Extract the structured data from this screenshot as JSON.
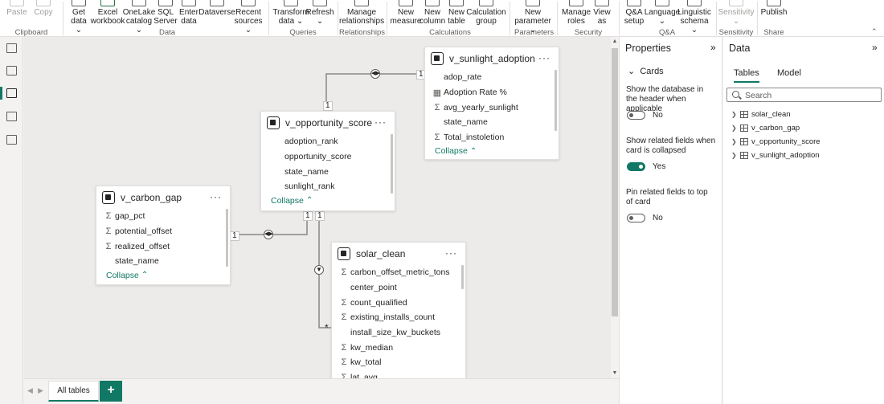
{
  "ribbon": {
    "buttons": [
      {
        "label": "Paste",
        "disabled": true
      },
      {
        "label": "Copy",
        "disabled": true
      },
      {
        "label": "Get data ⌄",
        "disabled": false
      },
      {
        "label": "Excel workbook",
        "disabled": false
      },
      {
        "label": "OneLake catalog ⌄",
        "disabled": false
      },
      {
        "label": "SQL Server",
        "disabled": false
      },
      {
        "label": "Enter data",
        "disabled": false
      },
      {
        "label": "Dataverse",
        "disabled": false
      },
      {
        "label": "Recent sources ⌄",
        "disabled": false
      },
      {
        "label": "Transform data ⌄",
        "disabled": false
      },
      {
        "label": "Refresh ⌄",
        "disabled": false
      },
      {
        "label": "Manage relationships",
        "disabled": false
      },
      {
        "label": "New measure",
        "disabled": false
      },
      {
        "label": "New column",
        "disabled": false
      },
      {
        "label": "New table",
        "disabled": false
      },
      {
        "label": "Calculation group",
        "disabled": false
      },
      {
        "label": "New parameter ⌄",
        "disabled": false
      },
      {
        "label": "Manage roles",
        "disabled": false
      },
      {
        "label": "View as",
        "disabled": false
      },
      {
        "label": "Q&A setup",
        "disabled": false
      },
      {
        "label": "Language ⌄",
        "disabled": false
      },
      {
        "label": "Linguistic schema ⌄",
        "disabled": false
      },
      {
        "label": "Sensitivity ⌄",
        "disabled": true
      },
      {
        "label": "Publish",
        "disabled": false
      }
    ],
    "groups": [
      "Clipboard",
      "Data",
      "Queries",
      "Relationships",
      "Calculations",
      "Parameters",
      "Security",
      "Q&A",
      "Sensitivity",
      "Share"
    ]
  },
  "cards": {
    "v_sunlight_adoption": {
      "title": "v_sunlight_adoption",
      "fields": [
        {
          "name": "adop_rate",
          "icon": ""
        },
        {
          "name": "Adoption Rate %",
          "icon": "measure-icon"
        },
        {
          "name": "avg_yearly_sunlight",
          "icon": "sigma"
        },
        {
          "name": "state_name",
          "icon": ""
        },
        {
          "name": "Total_instoletion",
          "icon": "sigma"
        }
      ],
      "collapse": "Collapse"
    },
    "v_opportunity_score": {
      "title": "v_opportunity_score",
      "fields": [
        {
          "name": "adoption_rank",
          "icon": ""
        },
        {
          "name": "opportunity_score",
          "icon": ""
        },
        {
          "name": "state_name",
          "icon": ""
        },
        {
          "name": "sunlight_rank",
          "icon": ""
        }
      ],
      "collapse": "Collapse"
    },
    "v_carbon_gap": {
      "title": "v_carbon_gap",
      "fields": [
        {
          "name": "gap_pct",
          "icon": "sigma"
        },
        {
          "name": "potential_offset",
          "icon": "sigma"
        },
        {
          "name": "realized_offset",
          "icon": "sigma"
        },
        {
          "name": "state_name",
          "icon": ""
        }
      ],
      "collapse": "Collapse"
    },
    "solar_clean": {
      "title": "solar_clean",
      "fields": [
        {
          "name": "carbon_offset_metric_tons",
          "icon": "sigma"
        },
        {
          "name": "center_point",
          "icon": ""
        },
        {
          "name": "count_qualified",
          "icon": "sigma"
        },
        {
          "name": "existing_installs_count",
          "icon": "sigma"
        },
        {
          "name": "install_size_kw_buckets",
          "icon": ""
        },
        {
          "name": "kw_median",
          "icon": "sigma"
        },
        {
          "name": "kw_total",
          "icon": "sigma"
        },
        {
          "name": "lat_avg",
          "icon": "sigma"
        }
      ]
    }
  },
  "relationships": {
    "one": "1",
    "many": "*"
  },
  "tabs": {
    "all_tables": "All tables",
    "add": "+"
  },
  "properties": {
    "title": "Properties",
    "section": "Cards",
    "options": [
      {
        "label": "Show the database in the header when applicable",
        "state": "No",
        "on": false
      },
      {
        "label": "Show related fields when card is collapsed",
        "state": "Yes",
        "on": true
      },
      {
        "label": "Pin related fields to top of card",
        "state": "No",
        "on": false
      }
    ]
  },
  "data_pane": {
    "title": "Data",
    "tabs": [
      "Tables",
      "Model"
    ],
    "search_placeholder": "Search",
    "tables": [
      "solar_clean",
      "v_carbon_gap",
      "v_opportunity_score",
      "v_sunlight_adoption"
    ]
  },
  "colors": {
    "accent": "#117865"
  }
}
